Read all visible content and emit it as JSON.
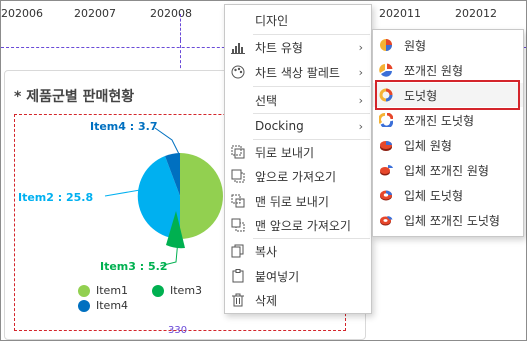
{
  "timeline": {
    "months": [
      "202006",
      "202007",
      "202008",
      "202011",
      "202012"
    ]
  },
  "panel": {
    "title": "* 제품군별 판매현황",
    "width_label": "330"
  },
  "chart_data": {
    "type": "pie",
    "categories": [
      "Item1",
      "Item2",
      "Item3",
      "Item4"
    ],
    "values": [
      null,
      25.8,
      5.2,
      3.7
    ],
    "colors": [
      "#92d050",
      "#00b0f0",
      "#00b050",
      "#0070c0"
    ],
    "labels": {
      "item4": "Item4 : 3.7",
      "item2": "Item2 : 25.8",
      "item3": "Item3 : 5.2"
    },
    "legend": [
      "Item1",
      "Item3",
      "Item4"
    ]
  },
  "context_menu": {
    "items": [
      {
        "label": "디자인",
        "icon": "none"
      },
      {
        "label": "차트 유형",
        "icon": "bar-chart-icon",
        "arrow": "›"
      },
      {
        "label": "차트 색상 팔레트",
        "icon": "palette-icon",
        "arrow": "›"
      },
      {
        "label": "선택",
        "icon": "none",
        "arrow": "›"
      },
      {
        "label": "Docking",
        "icon": "none",
        "arrow": "›"
      },
      {
        "label": "뒤로 보내기",
        "icon": "send-backward-icon"
      },
      {
        "label": "앞으로 가져오기",
        "icon": "bring-forward-icon"
      },
      {
        "label": "맨 뒤로 보내기",
        "icon": "send-to-back-icon"
      },
      {
        "label": "맨 앞으로 가져오기",
        "icon": "bring-to-front-icon"
      },
      {
        "label": "복사",
        "icon": "copy-icon"
      },
      {
        "label": "붙여넣기",
        "icon": "paste-icon"
      },
      {
        "label": "삭제",
        "icon": "trash-icon"
      }
    ]
  },
  "chart_type_submenu": {
    "items": [
      {
        "label": "원형",
        "icon": "pie-icon"
      },
      {
        "label": "쪼개진 원형",
        "icon": "exploded-pie-icon"
      },
      {
        "label": "도넛형",
        "icon": "doughnut-icon",
        "selected": true
      },
      {
        "label": "쪼개진 도넛형",
        "icon": "exploded-doughnut-icon"
      },
      {
        "label": "입체 원형",
        "icon": "pie-3d-icon"
      },
      {
        "label": "입체 쪼개진 원형",
        "icon": "exploded-pie-3d-icon"
      },
      {
        "label": "입체 도넛형",
        "icon": "doughnut-3d-icon"
      },
      {
        "label": "입체 쪼개진 도넛형",
        "icon": "exploded-doughnut-3d-icon"
      }
    ]
  }
}
